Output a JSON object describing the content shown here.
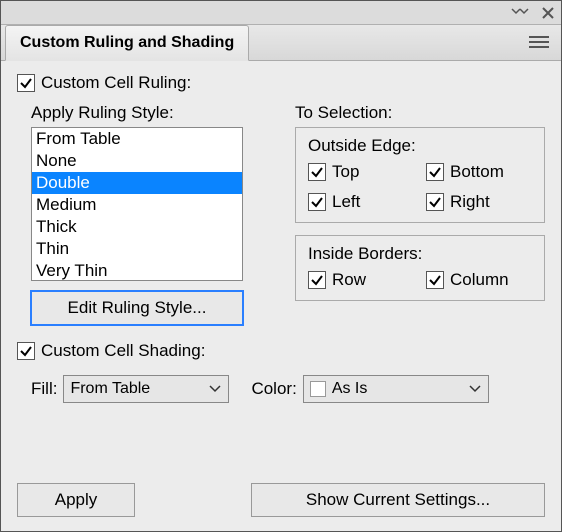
{
  "titlebar": {},
  "tab": {
    "label": "Custom Ruling and Shading"
  },
  "ruling": {
    "checkbox_label": "Custom Cell Ruling:",
    "apply_label": "Apply Ruling Style:",
    "styles": [
      "From Table",
      "None",
      "Double",
      "Medium",
      "Thick",
      "Thin",
      "Very Thin"
    ],
    "selected_index": 2,
    "edit_button": "Edit Ruling Style...",
    "to_selection_label": "To Selection:",
    "outside_edge": {
      "legend": "Outside Edge:",
      "top": "Top",
      "bottom": "Bottom",
      "left": "Left",
      "right": "Right"
    },
    "inside_borders": {
      "legend": "Inside Borders:",
      "row": "Row",
      "column": "Column"
    }
  },
  "shading": {
    "checkbox_label": "Custom Cell Shading:",
    "fill_label": "Fill:",
    "fill_value": "From Table",
    "color_label": "Color:",
    "color_value": "As Is"
  },
  "footer": {
    "apply": "Apply",
    "show": "Show Current Settings..."
  }
}
